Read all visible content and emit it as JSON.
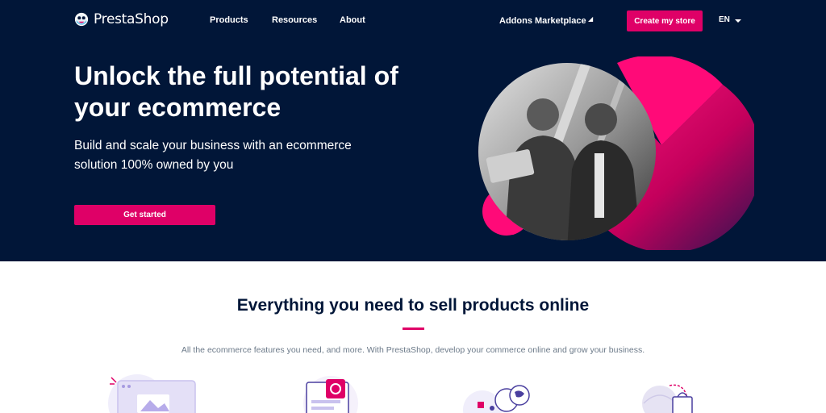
{
  "header": {
    "logo_text": "PrestaShop",
    "nav": {
      "products": "Products",
      "resources": "Resources",
      "about": "About",
      "addons": "Addons Marketplace"
    },
    "cta_label": "Create my store",
    "language": "EN"
  },
  "hero": {
    "title": "Unlock the full potential of your ecommerce",
    "subtitle": "Build and scale your business with an ecommerce solution 100% owned by you",
    "cta_label": "Get started"
  },
  "features": {
    "title": "Everything you need to sell products online",
    "subtitle": "All the ecommerce features you need, and more. With PrestaShop, develop your commerce online and grow your business."
  },
  "colors": {
    "navy": "#011638",
    "pink": "#df0067",
    "muted": "#6c7a89"
  },
  "icons": [
    "logo-icon",
    "dropdown-arrow-icon",
    "chevron-down-icon",
    "browser-window-icon",
    "clipboard-chart-icon",
    "analytics-globe-icon",
    "shopping-bag-globe-icon"
  ]
}
